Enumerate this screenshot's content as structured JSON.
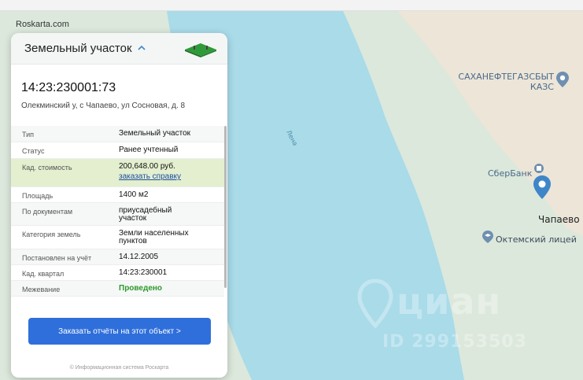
{
  "site": {
    "label": "Roskarta.com"
  },
  "card": {
    "title": "Земельный участок",
    "cad_number": "14:23:230001:73",
    "address": "Олекминский у, с Чапаево, ул Сосновая, д. 8",
    "rows": [
      {
        "key": "Тип",
        "value": "Земельный участок"
      },
      {
        "key": "Статус",
        "value": "Ранее учтенный"
      },
      {
        "key": "Кад. стоимость",
        "value": "200,648.00 руб.",
        "link": "заказать справку"
      },
      {
        "key": "Площадь",
        "value": "1400 м2"
      },
      {
        "key": "По документам",
        "value": "приусадебный",
        "value2": "участок"
      },
      {
        "key": "Категория земель",
        "value": "Земли населенных",
        "value2": "пунктов"
      },
      {
        "key": "Постановлен на учёт",
        "value": "14.12.2005"
      },
      {
        "key": "Кад. квартал",
        "value": "14:23:230001"
      },
      {
        "key": "Межевание",
        "value": "Проведено"
      }
    ],
    "cta_label": "Заказать отчёты на этот объект >",
    "footer": "© Информационная система Роскарта"
  },
  "map": {
    "labels": {
      "gas_line1": "САХАНЕФТЕГАЗСБЫТ",
      "gas_line2": "КАЗС",
      "bank": "СберБанк",
      "city": "Чапаево",
      "school": "Октемский лицей",
      "river": "Лена"
    },
    "watermark": {
      "brand": "циан",
      "id": "ID 299153503"
    }
  },
  "colors": {
    "water": "#a8dbe8",
    "land": "#dcead9",
    "sand": "#ece4d6",
    "accent": "#2f6fdb",
    "pin": "#3f86c8"
  }
}
